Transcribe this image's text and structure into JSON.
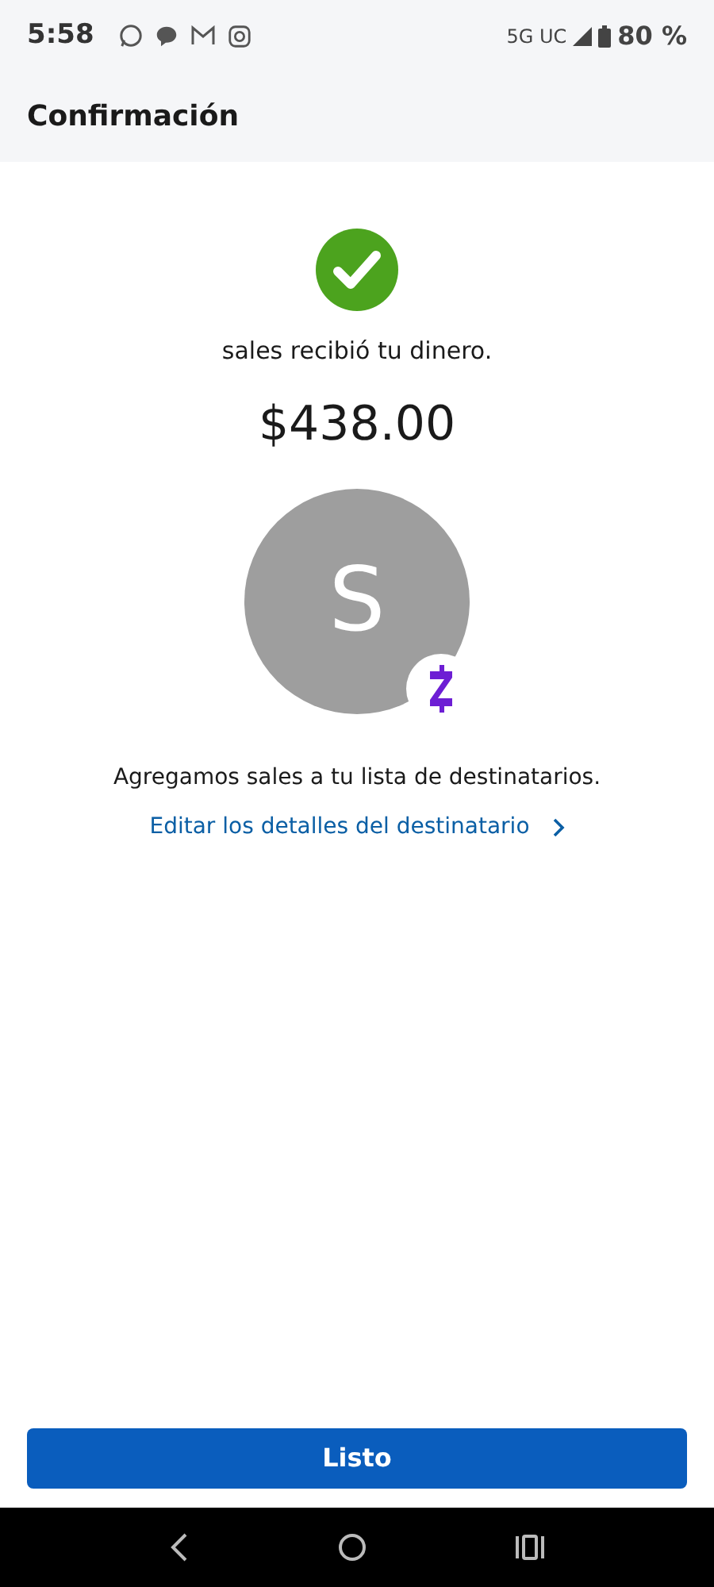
{
  "status_bar": {
    "time": "5:58",
    "network": "5G UC",
    "battery": "80 %"
  },
  "header": {
    "title": "Confirmación"
  },
  "confirmation": {
    "message": "sales recibió tu dinero.",
    "amount": "$438.00"
  },
  "recipient": {
    "initial": "S",
    "note": "Agregamos sales a tu lista de destinatarios.",
    "edit_link": "Editar los detalles del destinatario"
  },
  "buttons": [
    "Listo"
  ]
}
